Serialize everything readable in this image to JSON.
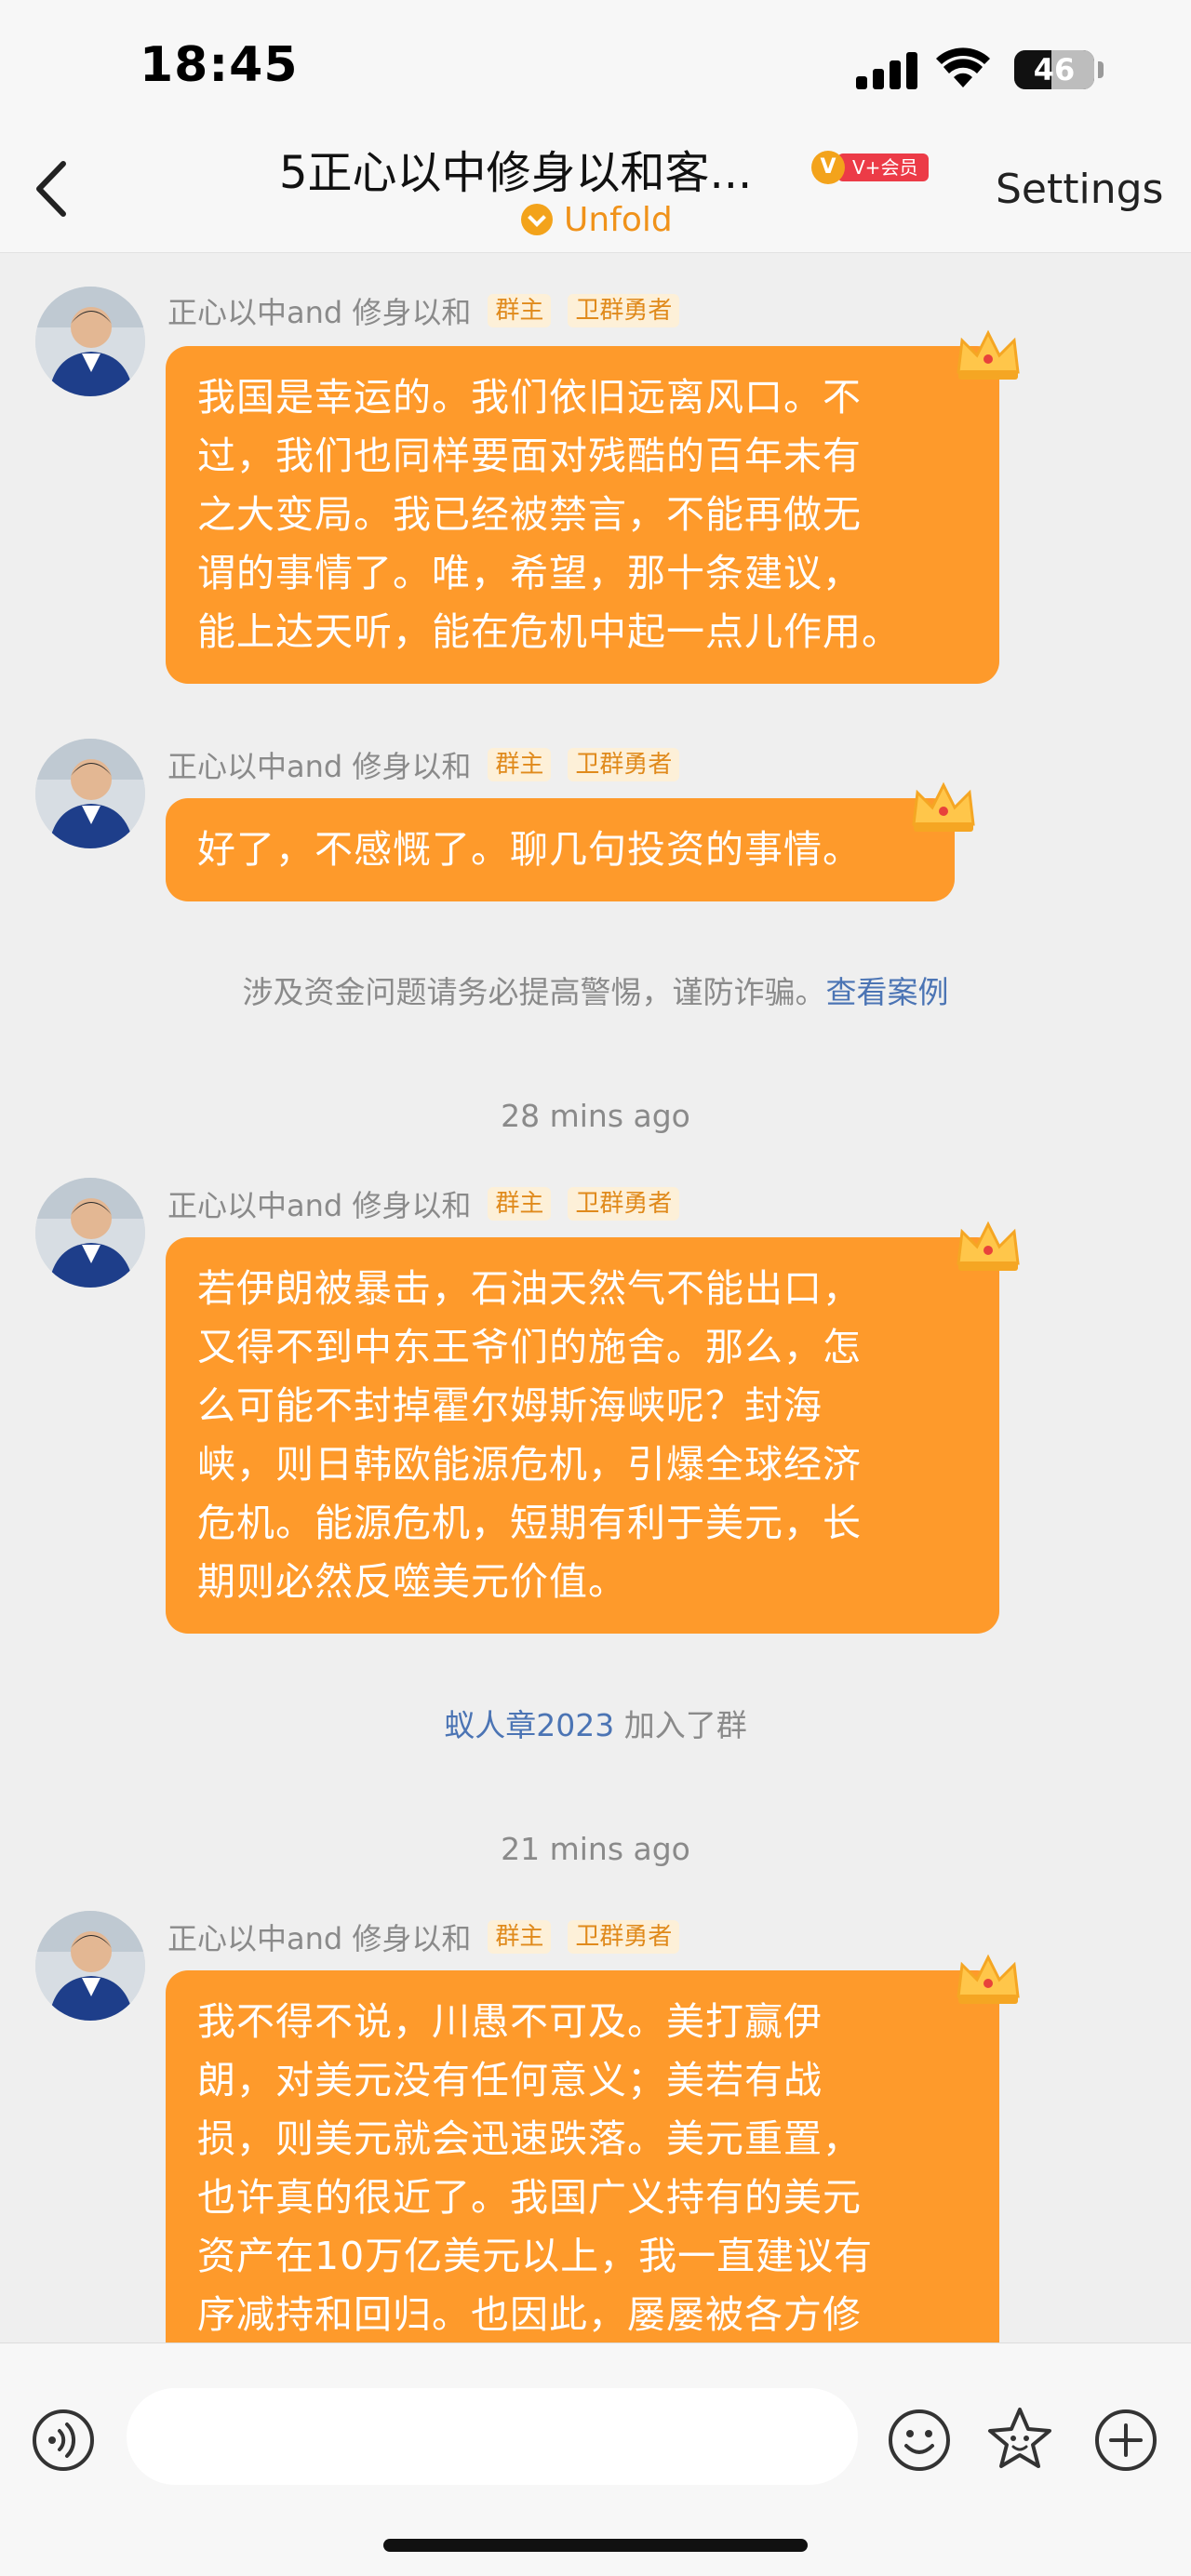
{
  "status_bar": {
    "time": "18:45",
    "battery": "46",
    "battery_level_percent": 46
  },
  "header": {
    "back_icon": "chevron-left-icon",
    "title": "5正心以中修身以和客...",
    "vip_badge": {
      "logo": "V",
      "label": "V+会员"
    },
    "unfold_label": "Unfold",
    "settings_label": "Settings"
  },
  "messages": [
    {
      "sender": "正心以中and 修身以和",
      "tags": [
        "群主",
        "卫群勇者"
      ],
      "lines": [
        "我国是幸运的。我们依旧远离风口。不",
        "过，我们也同样要面对残酷的百年未有",
        "之大变局。我已经被禁言，不能再做无",
        "谓的事情了。唯，希望，那十条建议，",
        "能上达天听，能在危机中起一点儿作用。"
      ]
    },
    {
      "sender": "正心以中and 修身以和",
      "tags": [
        "群主",
        "卫群勇者"
      ],
      "lines": [
        "好了，不感慨了。聊几句投资的事情。"
      ]
    },
    {
      "sender": "正心以中and 修身以和",
      "tags": [
        "群主",
        "卫群勇者"
      ],
      "lines": [
        "若伊朗被暴击，石油天然气不能出口，",
        "又得不到中东王爷们的施舍。那么，怎",
        "么可能不封掉霍尔姆斯海峡呢？封海",
        "峡，则日韩欧能源危机，引爆全球经济",
        "危机。能源危机，短期有利于美元，长",
        "期则必然反噬美元价值。"
      ]
    },
    {
      "sender": "正心以中and 修身以和",
      "tags": [
        "群主",
        "卫群勇者"
      ],
      "lines": [
        "我不得不说，川愚不可及。美打赢伊",
        "朗，对美元没有任何意义；美若有战",
        "损，则美元就会迅速跌落。美元重置，",
        "也许真的很近了。我国广义持有的美元",
        "资产在10万亿美元以上，我一直建议有",
        "序减持和回归。也因此，屡屡被各方修"
      ]
    }
  ],
  "fraud_notice": {
    "text": "涉及资金问题请务必提高警惕，谨防诈骗。",
    "link": "查看案例"
  },
  "timestamps": [
    "28 mins ago",
    "21 mins ago"
  ],
  "join_notice": {
    "member": "蚁人章2023",
    "action": " 加入了群"
  },
  "input_bar": {
    "placeholder": "",
    "icons": [
      "voice-icon",
      "emoji-icon",
      "sticker-icon",
      "plus-icon"
    ]
  },
  "colors": {
    "bubble": "#fe9a2b",
    "accent": "#f3a31b",
    "link": "#4b74b4",
    "background": "#efefef"
  }
}
